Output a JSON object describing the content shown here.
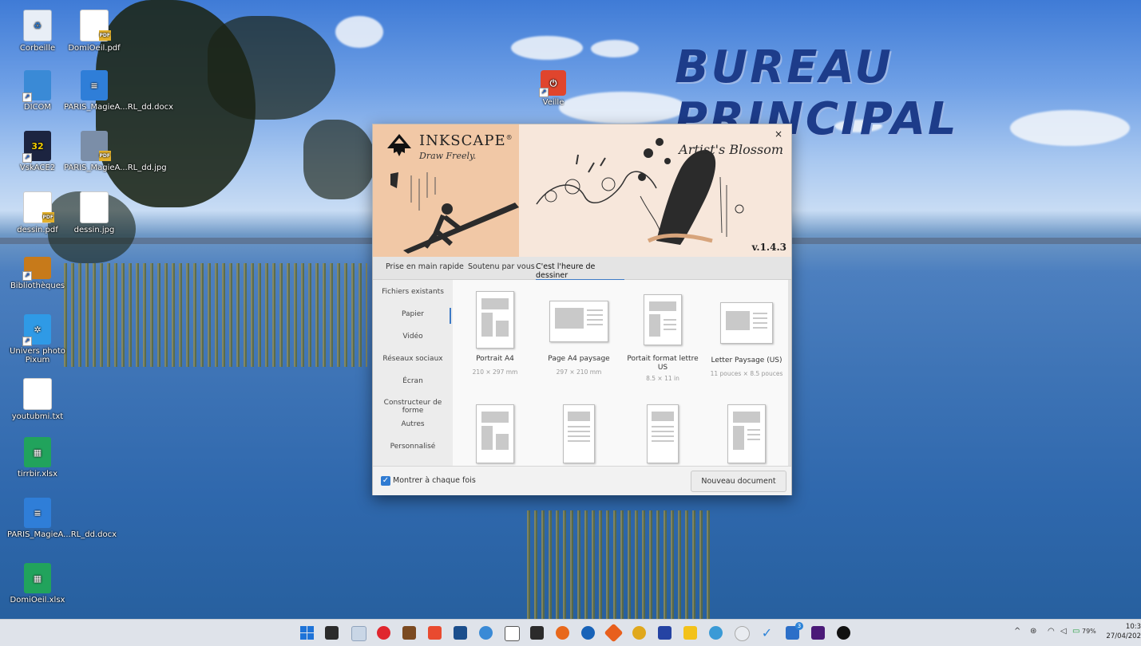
{
  "desktop": {
    "title": "BUREAU PRINCIPAL",
    "icons": [
      {
        "label": "Corbeille"
      },
      {
        "label": "DomiOeil.pdf"
      },
      {
        "label": "DICOM"
      },
      {
        "label": "PARIS_MagieA...RL_dd.docx"
      },
      {
        "label": "VskACE2"
      },
      {
        "label": "PARIS_MagieA...RL_dd.jpg"
      },
      {
        "label": "dessin.pdf"
      },
      {
        "label": "dessin.jpg"
      },
      {
        "label": "Bibliothèques"
      },
      {
        "label": "Univers photo Pixum"
      },
      {
        "label": "youtubmi.txt"
      },
      {
        "label": "tirrbir.xlsx"
      },
      {
        "label": "PARIS_MagieA...RL_dd.docx"
      },
      {
        "label": "DomiOeil.xlsx"
      },
      {
        "label": "Veille"
      }
    ],
    "badge_number": "32"
  },
  "dialog": {
    "brand": "INKSCAPE",
    "brand_mark": "®",
    "tagline": "Draw Freely.",
    "theme": "Artist's Blossom",
    "version": "v.1.4.3",
    "close_label": "×",
    "tabs": [
      {
        "label": "Prise en main rapide",
        "active": false
      },
      {
        "label": "Soutenu par vous",
        "active": false
      },
      {
        "label": "C'est l'heure de dessiner",
        "active": true
      }
    ],
    "categories": [
      {
        "label": "Fichiers existants"
      },
      {
        "label": "Papier",
        "selected": true
      },
      {
        "label": "Vidéo"
      },
      {
        "label": "Réseaux sociaux"
      },
      {
        "label": "Écran"
      },
      {
        "label": "Constructeur de forme"
      },
      {
        "label": "Autres"
      },
      {
        "label": "Personnalisé"
      }
    ],
    "templates": [
      {
        "name": "Portrait A4",
        "dims": "210 × 297 mm"
      },
      {
        "name": "Page A4 paysage",
        "dims": "297 × 210 mm"
      },
      {
        "name": "Portait format lettre US",
        "dims": "8.5 × 11 in"
      },
      {
        "name": "Letter Paysage (US)",
        "dims": "11 pouces × 8.5 pouces"
      }
    ],
    "show_each_time_label": "Montrer à chaque fois",
    "show_each_time_checked": true,
    "new_document_label": "Nouveau document"
  },
  "taskbar": {
    "battery": "79%",
    "time": "10:3",
    "date": "27/04/202",
    "tray_chevron": "^",
    "notification_badge": "3"
  },
  "colors": {
    "accent": "#3d7ac6",
    "banner_left": "#f1c8a6",
    "banner_right": "#f7e7db"
  }
}
